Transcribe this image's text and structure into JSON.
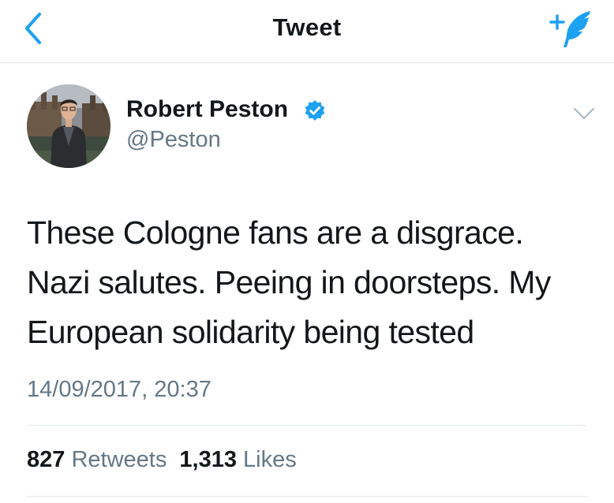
{
  "header": {
    "title": "Tweet",
    "back_icon": "chevron-left-icon",
    "compose_icon": "compose-tweet-icon"
  },
  "tweet": {
    "author": {
      "name": "Robert Peston",
      "handle": "@Peston",
      "verified": true
    },
    "text_lines": [
      "These Cologne fans are a disgrace.",
      "Nazi salutes. Peeing in doorsteps. My",
      "European solidarity being tested"
    ],
    "timestamp": "14/09/2017, 20:37",
    "stats": {
      "retweets_count": "827",
      "retweets_label": "Retweets",
      "likes_count": "1,313",
      "likes_label": "Likes"
    }
  },
  "colors": {
    "accent": "#1da1f2",
    "text_primary": "#14171a",
    "text_secondary": "#657786",
    "divider": "#e1e8ed"
  }
}
